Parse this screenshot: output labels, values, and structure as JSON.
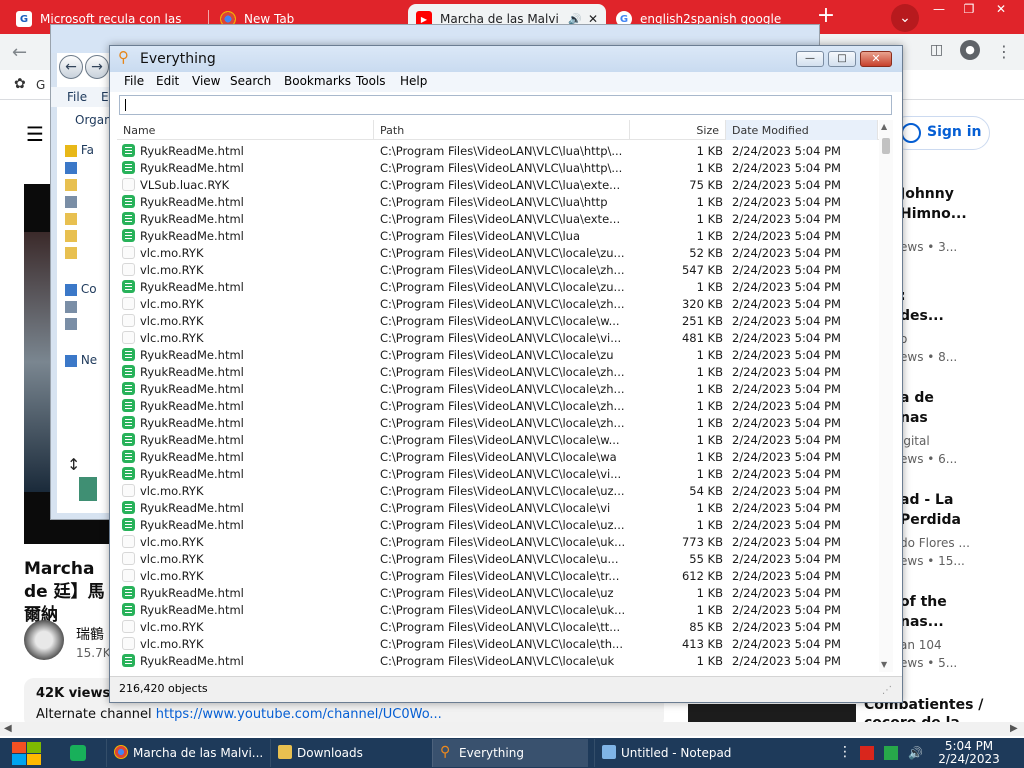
{
  "chrome": {
    "tabs": [
      {
        "title": "Microsoft recula con las",
        "icon": "g-news-icon"
      },
      {
        "title": "New Tab",
        "icon": "chrome-icon"
      },
      {
        "title": "Marcha de las Malvi",
        "icon": "youtube-icon"
      },
      {
        "title": "english2spanish google",
        "icon": "google-icon"
      }
    ],
    "new_tab": "+",
    "tab_search": "⌄",
    "window_controls": {
      "minimize": "—",
      "restore": "❐",
      "close": "✕"
    },
    "back": "←",
    "bookmarks_label": "G"
  },
  "youtube": {
    "sign_in": "Sign in",
    "video_title": "Marcha de 廷】馬爾納",
    "channel": "瑞鶴",
    "subscribers": "15.7K",
    "views": "42K views",
    "desc_prefix": "Alternate channel",
    "desc_link": "https://www.youtube.com/channel/UC0Wo...",
    "recommendations": [
      {
        "line1": "Johnny",
        "line2": "Himno...",
        "meta1": "ews • 3..."
      },
      {
        "line1": ":",
        "line2": "des...",
        "meta1": "o",
        "meta2": "ews • 8..."
      },
      {
        "line1": "a de",
        "line2": "nas",
        "meta1": "igital",
        "meta2": "ews • 6..."
      },
      {
        "line1": "ad - La",
        "line2": "Perdida",
        "meta1": "do Flores ...",
        "meta2": "ews • 15..."
      },
      {
        "line1": " of the",
        "line2": "nas...",
        "meta1": "an 104",
        "meta2": "ews • 5..."
      }
    ],
    "last_rec_title": "Combatientes /",
    "last_rec_title2": "cocoro de la..."
  },
  "explorer": {
    "menu": [
      "File",
      "E"
    ],
    "organize": "Organ",
    "tree": [
      {
        "label": "Fa",
        "icon": "star-icon",
        "color": "#e8b818"
      },
      {
        "label": "",
        "icon": "desktop-icon",
        "color": "#3b78c8"
      },
      {
        "label": "",
        "icon": "folder-icon",
        "color": "#e8c050"
      },
      {
        "label": "",
        "icon": "drive-icon",
        "color": "#7a8ea6"
      },
      {
        "label": "",
        "icon": "folder-icon",
        "color": "#e8c050"
      },
      {
        "label": "",
        "icon": "folder-icon",
        "color": "#e8c050"
      },
      {
        "label": "",
        "icon": "folder-icon",
        "color": "#e8c050"
      },
      {
        "label": "Co",
        "icon": "computer-icon",
        "color": "#3b78c8"
      },
      {
        "label": "",
        "icon": "drive-icon",
        "color": "#7a8ea6"
      },
      {
        "label": "",
        "icon": "drive-icon",
        "color": "#7a8ea6"
      },
      {
        "label": "Ne",
        "icon": "network-icon",
        "color": "#3b78c8"
      }
    ]
  },
  "everything": {
    "title": "Everything",
    "menu": [
      "File",
      "Edit",
      "View",
      "Search",
      "Bookmarks",
      "Tools",
      "Help"
    ],
    "search_value": "",
    "columns": {
      "name": "Name",
      "path": "Path",
      "size": "Size",
      "date": "Date Modified"
    },
    "rows": [
      {
        "name": "RyukReadMe.html",
        "path": "C:\\Program Files\\VideoLAN\\VLC\\lua\\http\\...",
        "size": "1 KB",
        "date": "2/24/2023 5:04 PM",
        "type": "html"
      },
      {
        "name": "RyukReadMe.html",
        "path": "C:\\Program Files\\VideoLAN\\VLC\\lua\\http\\...",
        "size": "1 KB",
        "date": "2/24/2023 5:04 PM",
        "type": "html"
      },
      {
        "name": "VLSub.luac.RYK",
        "path": "C:\\Program Files\\VideoLAN\\VLC\\lua\\exte...",
        "size": "75 KB",
        "date": "2/24/2023 5:04 PM",
        "type": "file"
      },
      {
        "name": "RyukReadMe.html",
        "path": "C:\\Program Files\\VideoLAN\\VLC\\lua\\http",
        "size": "1 KB",
        "date": "2/24/2023 5:04 PM",
        "type": "html"
      },
      {
        "name": "RyukReadMe.html",
        "path": "C:\\Program Files\\VideoLAN\\VLC\\lua\\exte...",
        "size": "1 KB",
        "date": "2/24/2023 5:04 PM",
        "type": "html"
      },
      {
        "name": "RyukReadMe.html",
        "path": "C:\\Program Files\\VideoLAN\\VLC\\lua",
        "size": "1 KB",
        "date": "2/24/2023 5:04 PM",
        "type": "html"
      },
      {
        "name": "vlc.mo.RYK",
        "path": "C:\\Program Files\\VideoLAN\\VLC\\locale\\zu...",
        "size": "52 KB",
        "date": "2/24/2023 5:04 PM",
        "type": "file"
      },
      {
        "name": "vlc.mo.RYK",
        "path": "C:\\Program Files\\VideoLAN\\VLC\\locale\\zh...",
        "size": "547 KB",
        "date": "2/24/2023 5:04 PM",
        "type": "file"
      },
      {
        "name": "RyukReadMe.html",
        "path": "C:\\Program Files\\VideoLAN\\VLC\\locale\\zu...",
        "size": "1 KB",
        "date": "2/24/2023 5:04 PM",
        "type": "html"
      },
      {
        "name": "vlc.mo.RYK",
        "path": "C:\\Program Files\\VideoLAN\\VLC\\locale\\zh...",
        "size": "320 KB",
        "date": "2/24/2023 5:04 PM",
        "type": "file"
      },
      {
        "name": "vlc.mo.RYK",
        "path": "C:\\Program Files\\VideoLAN\\VLC\\locale\\w...",
        "size": "251 KB",
        "date": "2/24/2023 5:04 PM",
        "type": "file"
      },
      {
        "name": "vlc.mo.RYK",
        "path": "C:\\Program Files\\VideoLAN\\VLC\\locale\\vi...",
        "size": "481 KB",
        "date": "2/24/2023 5:04 PM",
        "type": "file"
      },
      {
        "name": "RyukReadMe.html",
        "path": "C:\\Program Files\\VideoLAN\\VLC\\locale\\zu",
        "size": "1 KB",
        "date": "2/24/2023 5:04 PM",
        "type": "html"
      },
      {
        "name": "RyukReadMe.html",
        "path": "C:\\Program Files\\VideoLAN\\VLC\\locale\\zh...",
        "size": "1 KB",
        "date": "2/24/2023 5:04 PM",
        "type": "html"
      },
      {
        "name": "RyukReadMe.html",
        "path": "C:\\Program Files\\VideoLAN\\VLC\\locale\\zh...",
        "size": "1 KB",
        "date": "2/24/2023 5:04 PM",
        "type": "html"
      },
      {
        "name": "RyukReadMe.html",
        "path": "C:\\Program Files\\VideoLAN\\VLC\\locale\\zh...",
        "size": "1 KB",
        "date": "2/24/2023 5:04 PM",
        "type": "html"
      },
      {
        "name": "RyukReadMe.html",
        "path": "C:\\Program Files\\VideoLAN\\VLC\\locale\\zh...",
        "size": "1 KB",
        "date": "2/24/2023 5:04 PM",
        "type": "html"
      },
      {
        "name": "RyukReadMe.html",
        "path": "C:\\Program Files\\VideoLAN\\VLC\\locale\\w...",
        "size": "1 KB",
        "date": "2/24/2023 5:04 PM",
        "type": "html"
      },
      {
        "name": "RyukReadMe.html",
        "path": "C:\\Program Files\\VideoLAN\\VLC\\locale\\wa",
        "size": "1 KB",
        "date": "2/24/2023 5:04 PM",
        "type": "html"
      },
      {
        "name": "RyukReadMe.html",
        "path": "C:\\Program Files\\VideoLAN\\VLC\\locale\\vi...",
        "size": "1 KB",
        "date": "2/24/2023 5:04 PM",
        "type": "html"
      },
      {
        "name": "vlc.mo.RYK",
        "path": "C:\\Program Files\\VideoLAN\\VLC\\locale\\uz...",
        "size": "54 KB",
        "date": "2/24/2023 5:04 PM",
        "type": "file"
      },
      {
        "name": "RyukReadMe.html",
        "path": "C:\\Program Files\\VideoLAN\\VLC\\locale\\vi",
        "size": "1 KB",
        "date": "2/24/2023 5:04 PM",
        "type": "html"
      },
      {
        "name": "RyukReadMe.html",
        "path": "C:\\Program Files\\VideoLAN\\VLC\\locale\\uz...",
        "size": "1 KB",
        "date": "2/24/2023 5:04 PM",
        "type": "html"
      },
      {
        "name": "vlc.mo.RYK",
        "path": "C:\\Program Files\\VideoLAN\\VLC\\locale\\uk...",
        "size": "773 KB",
        "date": "2/24/2023 5:04 PM",
        "type": "file"
      },
      {
        "name": "vlc.mo.RYK",
        "path": "C:\\Program Files\\VideoLAN\\VLC\\locale\\u...",
        "size": "55 KB",
        "date": "2/24/2023 5:04 PM",
        "type": "file"
      },
      {
        "name": "vlc.mo.RYK",
        "path": "C:\\Program Files\\VideoLAN\\VLC\\locale\\tr...",
        "size": "612 KB",
        "date": "2/24/2023 5:04 PM",
        "type": "file"
      },
      {
        "name": "RyukReadMe.html",
        "path": "C:\\Program Files\\VideoLAN\\VLC\\locale\\uz",
        "size": "1 KB",
        "date": "2/24/2023 5:04 PM",
        "type": "html"
      },
      {
        "name": "RyukReadMe.html",
        "path": "C:\\Program Files\\VideoLAN\\VLC\\locale\\uk...",
        "size": "1 KB",
        "date": "2/24/2023 5:04 PM",
        "type": "html"
      },
      {
        "name": "vlc.mo.RYK",
        "path": "C:\\Program Files\\VideoLAN\\VLC\\locale\\tt...",
        "size": "85 KB",
        "date": "2/24/2023 5:04 PM",
        "type": "file"
      },
      {
        "name": "vlc.mo.RYK",
        "path": "C:\\Program Files\\VideoLAN\\VLC\\locale\\th...",
        "size": "413 KB",
        "date": "2/24/2023 5:04 PM",
        "type": "file"
      },
      {
        "name": "RyukReadMe.html",
        "path": "C:\\Program Files\\VideoLAN\\VLC\\locale\\uk",
        "size": "1 KB",
        "date": "2/24/2023 5:04 PM",
        "type": "html"
      }
    ],
    "status": "216,420 objects"
  },
  "taskbar": {
    "items": [
      {
        "label": "Marcha de las Malvi...",
        "icon": "chrome-icon"
      },
      {
        "label": "Downloads",
        "icon": "folder-icon"
      },
      {
        "label": "Everything",
        "icon": "everything-icon"
      },
      {
        "label": "Untitled - Notepad",
        "icon": "notepad-icon"
      }
    ],
    "time": "5:04 PM",
    "date": "2/24/2023"
  },
  "colors": {
    "chrome_tabstrip": "#e0242a",
    "everything_html_icon": "#28b25a",
    "taskbar": "#1e3a5a",
    "youtube_link": "#065fd4"
  }
}
